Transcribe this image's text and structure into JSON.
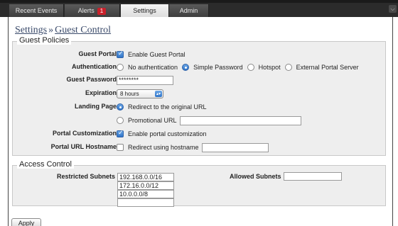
{
  "tabs": [
    {
      "label": "Recent Events"
    },
    {
      "label": "Alerts",
      "badge": "1"
    },
    {
      "label": "Settings",
      "active": true
    },
    {
      "label": "Admin"
    }
  ],
  "corner_icon": "chevron-down-icon",
  "breadcrumb": {
    "root": "Settings",
    "separator": "»",
    "current": "Guest Control"
  },
  "guest_policies": {
    "legend": "Guest Policies",
    "guest_portal": {
      "label": "Guest Portal",
      "option": "Enable Guest Portal",
      "checked": true
    },
    "authentication": {
      "label": "Authentication",
      "options": [
        "No authentication",
        "Simple Password",
        "Hotspot",
        "External Portal Server"
      ],
      "selected": "Simple Password"
    },
    "guest_password": {
      "label": "Guest Password",
      "value": "********"
    },
    "expiration": {
      "label": "Expiration",
      "value": "8 hours"
    },
    "landing_page": {
      "label": "Landing Page",
      "options": [
        "Redirect to the original URL",
        "Promotional URL"
      ],
      "selected": "Redirect to the original URL",
      "promotional_url": ""
    },
    "portal_customization": {
      "label": "Portal Customization",
      "option": "Enable portal customization",
      "checked": true
    },
    "portal_url_hostname": {
      "label": "Portal URL Hostname",
      "option": "Redirect using hostname",
      "checked": false,
      "value": ""
    }
  },
  "access_control": {
    "legend": "Access Control",
    "restricted_label": "Restricted Subnets",
    "restricted": [
      "192.168.0.0/16",
      "172.16.0.0/12",
      "10.0.0.0/8",
      ""
    ],
    "allowed_label": "Allowed Subnets",
    "allowed": [
      ""
    ]
  },
  "apply_label": "Apply",
  "colors": {
    "topbar": "#2b2b2b",
    "accent": "#2f74c8",
    "badge": "#c9202a",
    "link": "#3a4a6a",
    "panel": "#eeeeee"
  }
}
